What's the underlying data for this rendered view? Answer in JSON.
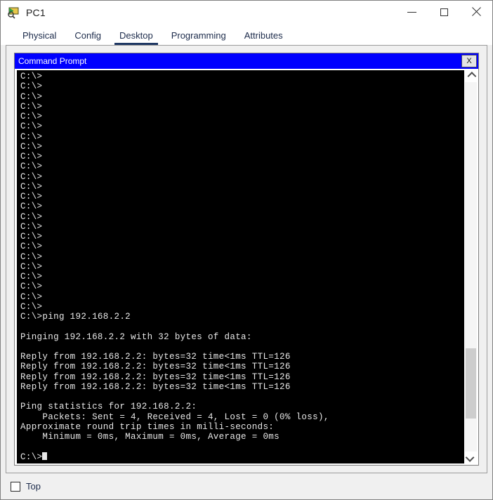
{
  "window": {
    "title": "PC1",
    "icon": "device-pc-icon",
    "controls": {
      "minimize": "minimize-icon",
      "maximize": "maximize-icon",
      "close": "close-icon"
    }
  },
  "tabs": [
    {
      "label": "Physical",
      "active": false
    },
    {
      "label": "Config",
      "active": false
    },
    {
      "label": "Desktop",
      "active": true
    },
    {
      "label": "Programming",
      "active": false
    },
    {
      "label": "Attributes",
      "active": false
    }
  ],
  "command_prompt": {
    "title": "Command Prompt",
    "close_label": "X",
    "background_color": "#000000",
    "titlebar_color": "#0000ff",
    "text_color": "#e8e8e8",
    "lines": [
      "C:\\>",
      "C:\\>",
      "C:\\>",
      "C:\\>",
      "C:\\>",
      "C:\\>",
      "C:\\>",
      "C:\\>",
      "C:\\>",
      "C:\\>",
      "C:\\>",
      "C:\\>",
      "C:\\>",
      "C:\\>",
      "C:\\>",
      "C:\\>",
      "C:\\>",
      "C:\\>",
      "C:\\>",
      "C:\\>",
      "C:\\>",
      "C:\\>",
      "C:\\>",
      "C:\\>",
      "C:\\>ping 192.168.2.2",
      "",
      "Pinging 192.168.2.2 with 32 bytes of data:",
      "",
      "Reply from 192.168.2.2: bytes=32 time<1ms TTL=126",
      "Reply from 192.168.2.2: bytes=32 time<1ms TTL=126",
      "Reply from 192.168.2.2: bytes=32 time<1ms TTL=126",
      "Reply from 192.168.2.2: bytes=32 time<1ms TTL=126",
      "",
      "Ping statistics for 192.168.2.2:",
      "    Packets: Sent = 4, Received = 4, Lost = 0 (0% loss),",
      "Approximate round trip times in milli-seconds:",
      "    Minimum = 0ms, Maximum = 0ms, Average = 0ms",
      ""
    ],
    "prompt_line": "C:\\>",
    "cursor_visible": true,
    "scrollbar": {
      "up_arrow": "chevron-up-icon",
      "down_arrow": "chevron-down-icon",
      "thumb_top_percent": 72,
      "thumb_height_percent": 19
    }
  },
  "footer": {
    "top_checkbox_label": "Top",
    "top_checkbox_checked": false
  }
}
